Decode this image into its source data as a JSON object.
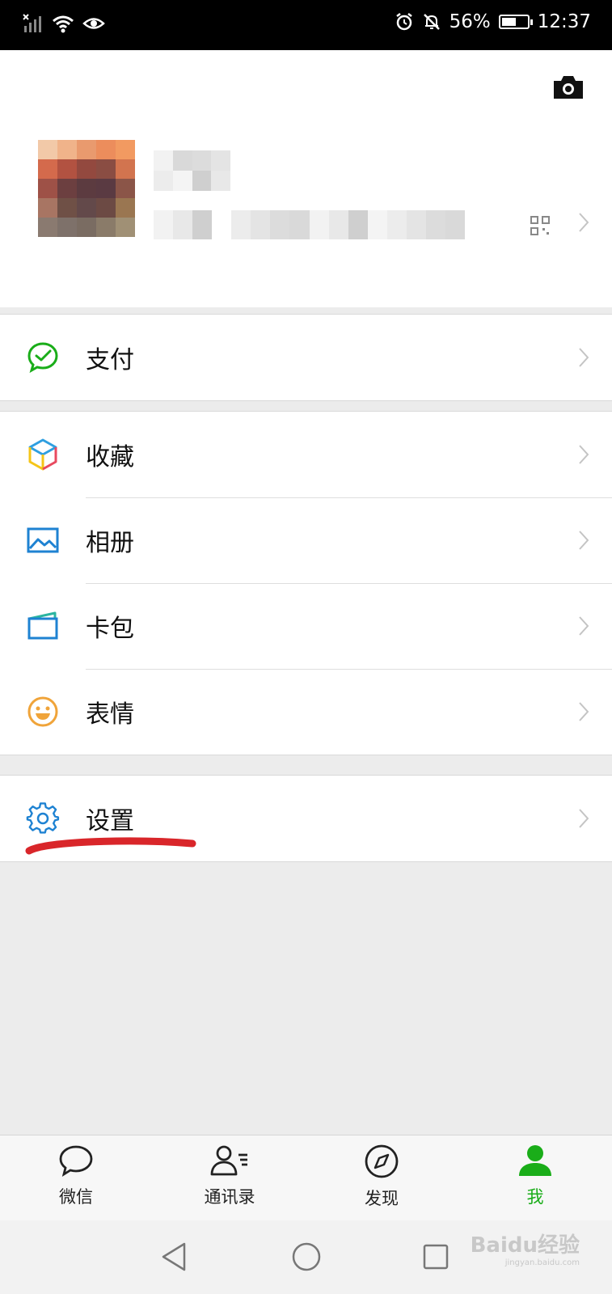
{
  "status_bar": {
    "battery": "56%",
    "time": "12:37",
    "battery_level": 0.56
  },
  "profile": {
    "camera_icon": "camera-icon",
    "qr_icon": "qr-code-icon"
  },
  "menu_groups": [
    {
      "items": [
        {
          "label": "支付",
          "icon": "pay-icon"
        }
      ]
    },
    {
      "items": [
        {
          "label": "收藏",
          "icon": "favorites-icon"
        },
        {
          "label": "相册",
          "icon": "album-icon"
        },
        {
          "label": "卡包",
          "icon": "card-wallet-icon"
        },
        {
          "label": "表情",
          "icon": "emoji-icon"
        }
      ]
    },
    {
      "items": [
        {
          "label": "设置",
          "icon": "settings-icon"
        }
      ]
    }
  ],
  "tabbar": {
    "tabs": [
      {
        "label": "微信",
        "icon": "chat-icon",
        "active": false
      },
      {
        "label": "通讯录",
        "icon": "contacts-icon",
        "active": false
      },
      {
        "label": "发现",
        "icon": "compass-icon",
        "active": false
      },
      {
        "label": "我",
        "icon": "me-icon",
        "active": true
      }
    ]
  },
  "colors": {
    "accent_green": "#1aad19",
    "annotation_red": "#d9262a",
    "blue_icon": "#1e82d2"
  },
  "watermark": {
    "brand": "Baidu经验",
    "url": "jingyan.baidu.com"
  }
}
